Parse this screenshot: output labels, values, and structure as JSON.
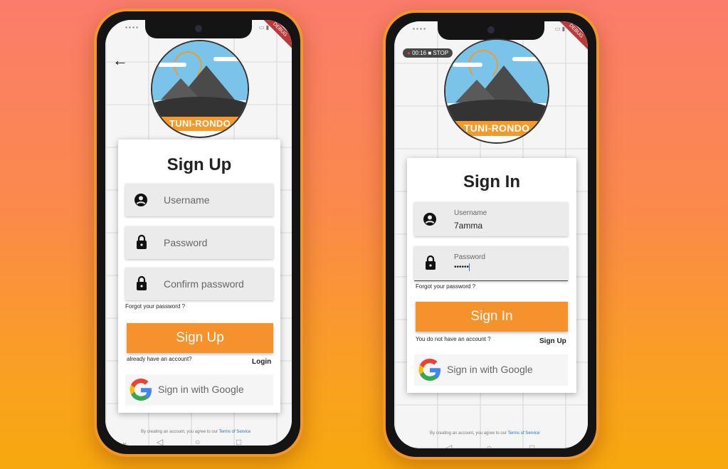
{
  "colors": {
    "accent": "#f6922c",
    "brand_sky": "#7ac4ea",
    "link": "#2a6fc0"
  },
  "logo_text": "TUNI-RONDO",
  "status_debug": "DEBUG",
  "signup": {
    "title": "Sign Up",
    "username_placeholder": "Username",
    "password_placeholder": "Password",
    "confirm_placeholder": "Confirm password",
    "forgot": "Forgot your password ?",
    "button": "Sign Up",
    "already": "already have an account?",
    "login": "Login",
    "google": "Sign in with Google",
    "terms_prefix": "By creating an account, you agree to our ",
    "terms_link": "Terms of Service"
  },
  "signin": {
    "rec_time": "00:16",
    "rec_stop": "STOP",
    "title": "Sign In",
    "username_label": "Username",
    "username_value": "7amma",
    "password_label": "Password",
    "password_value": "••••••",
    "forgot": "Forgot your password ?",
    "button": "Sign In",
    "no_account": "You do not have an account ?",
    "signup": "Sign Up",
    "google": "Sign in with Google",
    "terms_prefix": "By creating an account, you agree to our ",
    "terms_link": "Terms of Service"
  },
  "icons": [
    "back-arrow-icon",
    "user-icon",
    "lock-icon",
    "google-icon",
    "nav-back-icon",
    "nav-home-icon",
    "nav-recents-icon"
  ]
}
